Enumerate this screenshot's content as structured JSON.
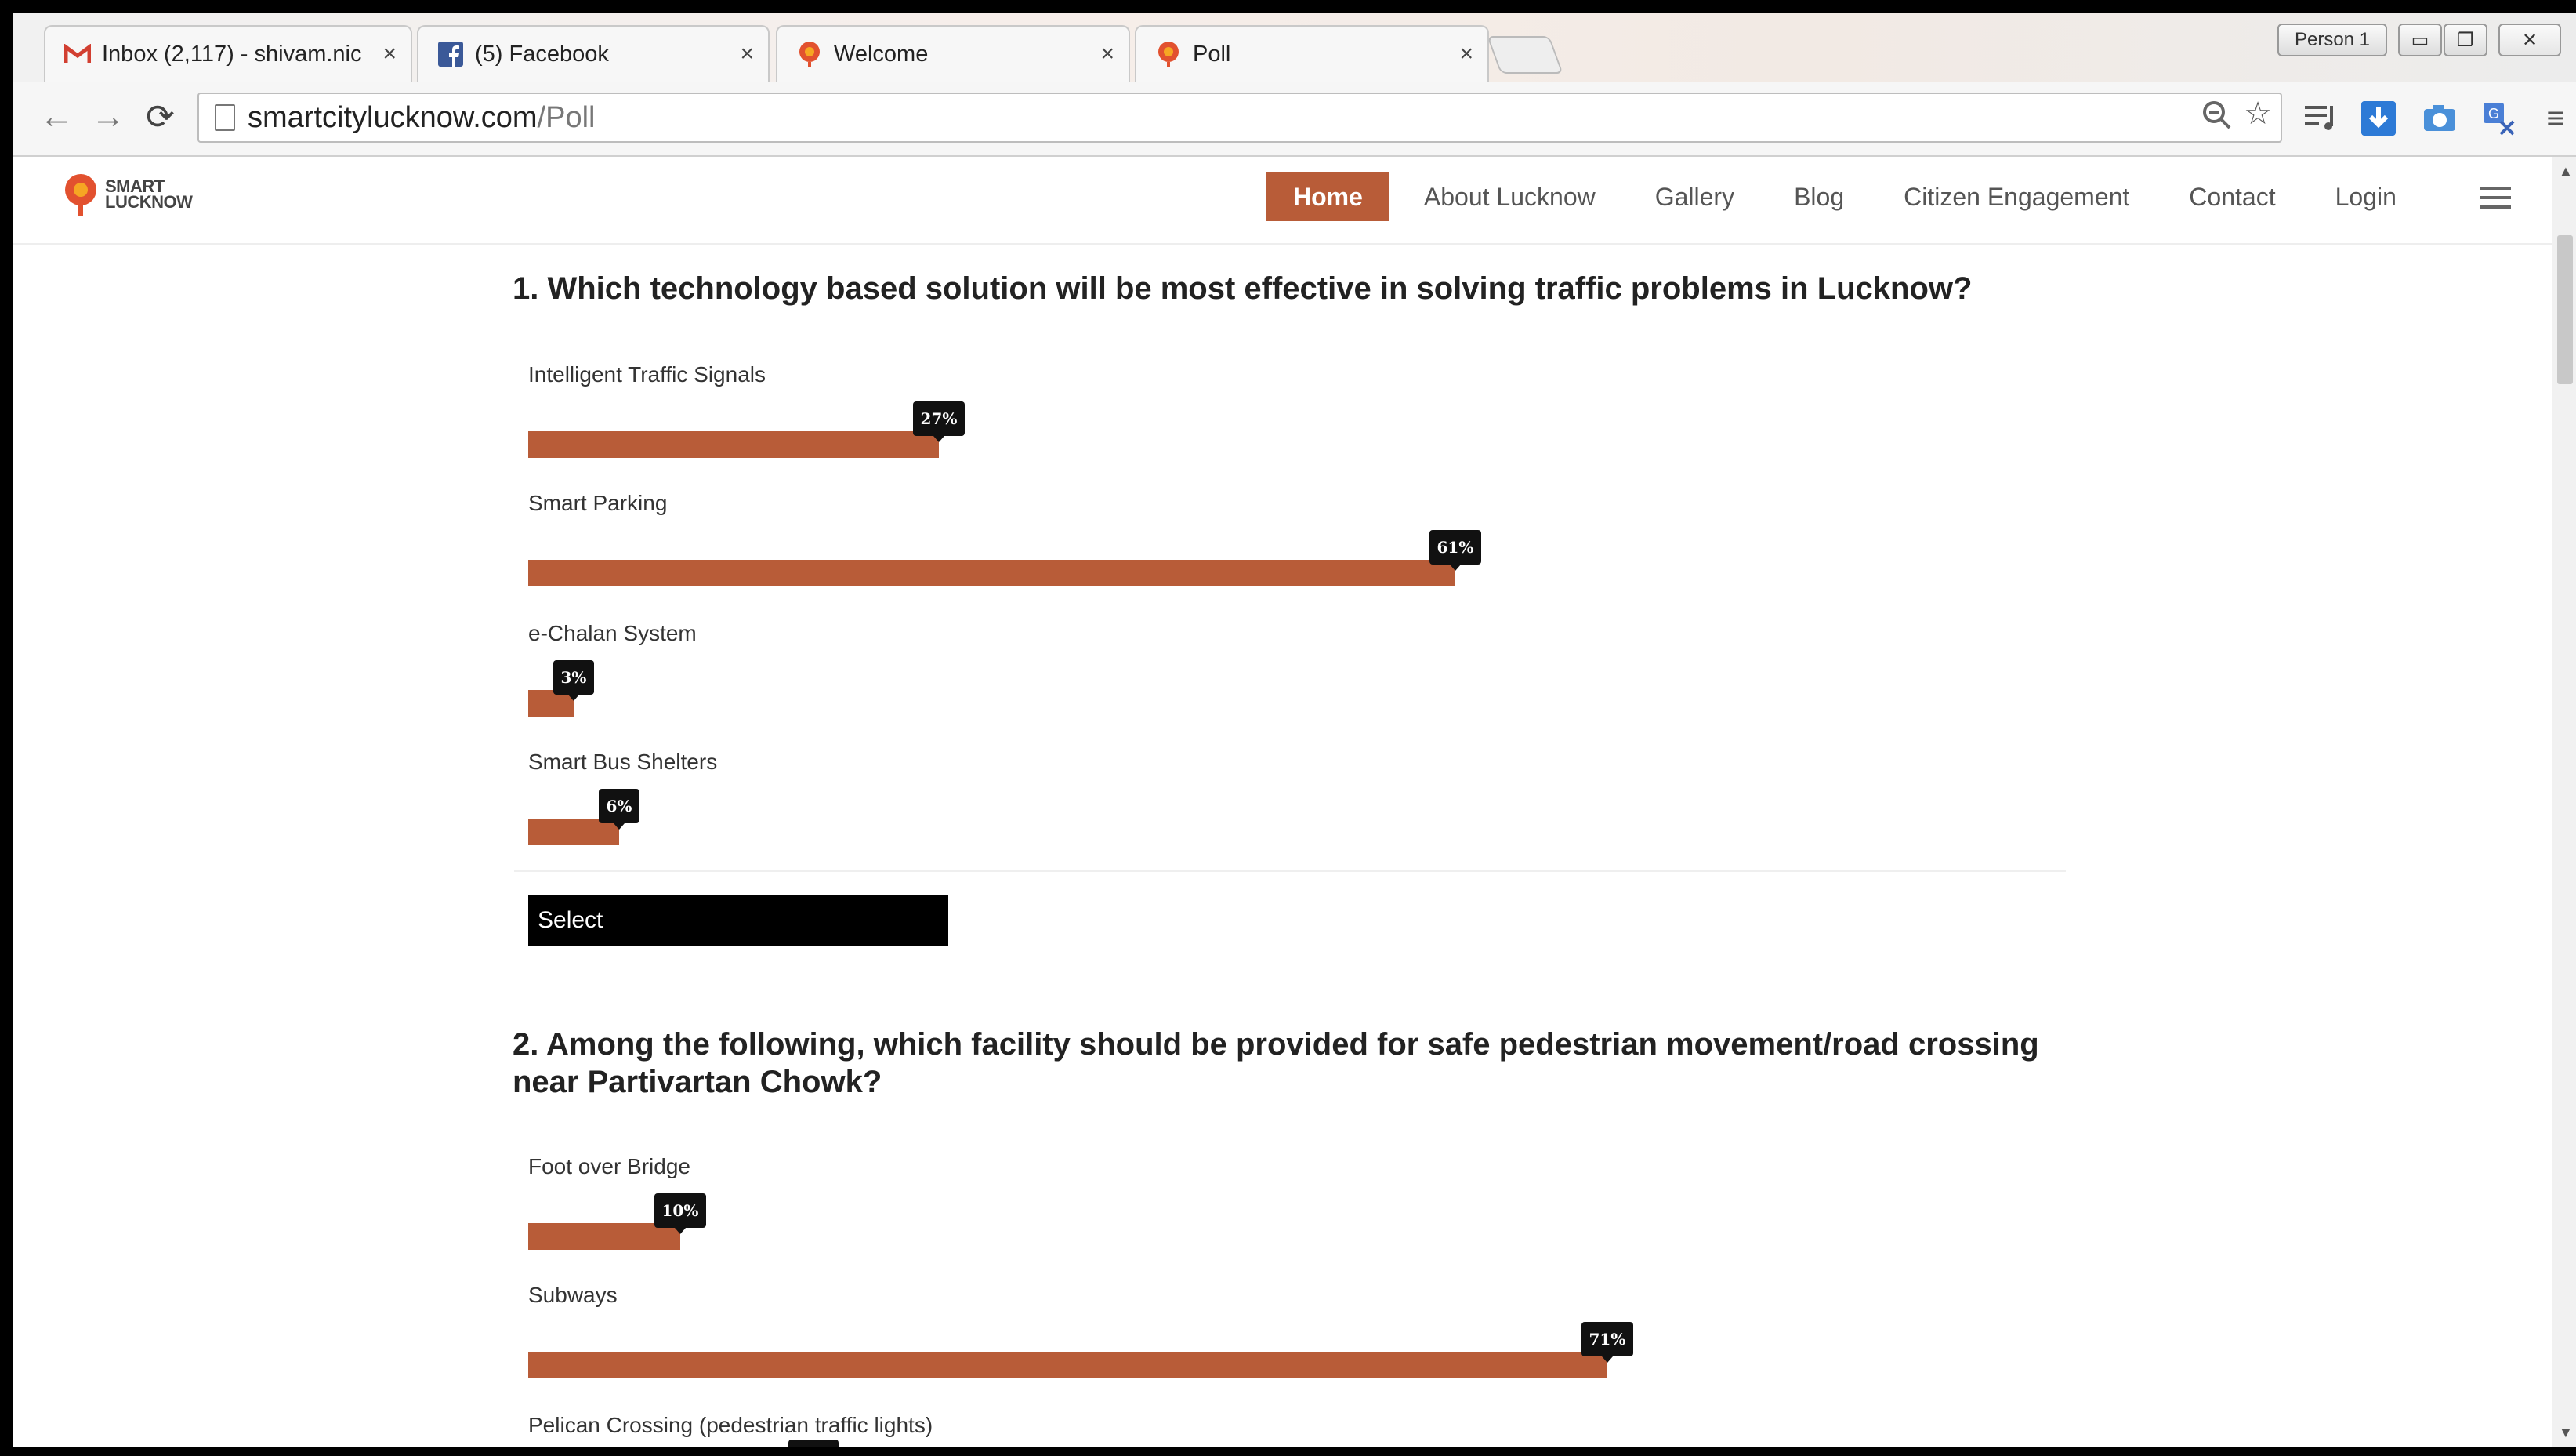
{
  "browser": {
    "tabs": [
      {
        "label": "Inbox (2,117) - shivam.nic",
        "icon": "gmail-icon",
        "close": "×"
      },
      {
        "label": "(5) Facebook",
        "icon": "facebook-icon",
        "close": "×"
      },
      {
        "label": "Welcome",
        "icon": "smartcity-icon",
        "close": "×"
      },
      {
        "label": "Poll",
        "icon": "smartcity-icon",
        "close": "×"
      }
    ],
    "profile": "Person 1",
    "url_host": "smartcitylucknow.com",
    "url_path": "/Poll"
  },
  "site": {
    "logo_line1": "SMART",
    "logo_line2": "LUCKNOW",
    "nav": [
      "Home",
      "About Lucknow",
      "Gallery",
      "Blog",
      "Citizen Engagement",
      "Contact",
      "Login"
    ],
    "active_nav": "Home",
    "accent_color": "#b85c38"
  },
  "polls": [
    {
      "question": "1. Which technology based solution will be most effective in solving traffic problems in Lucknow?",
      "options": [
        {
          "label": "Intelligent Traffic Signals",
          "percent": 27,
          "tip": "27%"
        },
        {
          "label": "Smart Parking",
          "percent": 61,
          "tip": "61%"
        },
        {
          "label": "e-Chalan System",
          "percent": 3,
          "tip": "3%"
        },
        {
          "label": "Smart Bus Shelters",
          "percent": 6,
          "tip": "6%"
        }
      ],
      "select_label": "Select"
    },
    {
      "question_line1": "2. Among the following, which facility should be provided for safe pedestrian movement/road crossing",
      "question_line2": "near Partivartan Chowk?",
      "options": [
        {
          "label": "Foot over Bridge",
          "percent": 10,
          "tip": "10%"
        },
        {
          "label": "Subways",
          "percent": 71,
          "tip": "71%"
        },
        {
          "label": "Pelican Crossing (pedestrian traffic lights)"
        }
      ]
    }
  ]
}
